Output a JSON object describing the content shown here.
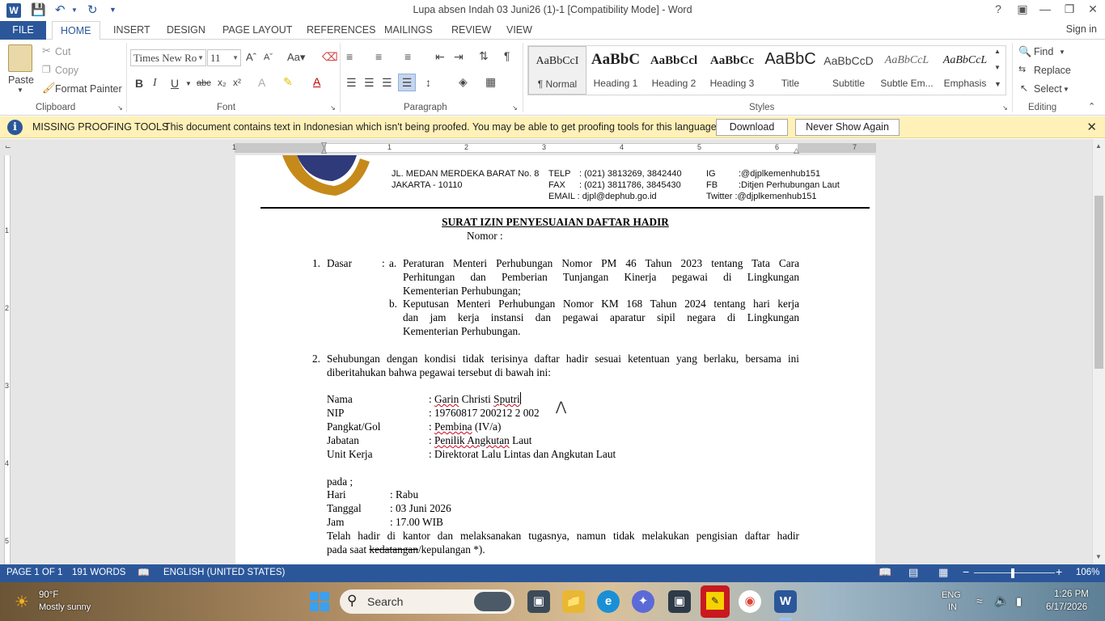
{
  "window": {
    "title": "Lupa absen Indah 03 Juni26 (1)-1 [Compatibility Mode] - Word",
    "logo": "W"
  },
  "tabs": {
    "file": "FILE",
    "items": [
      "HOME",
      "INSERT",
      "DESIGN",
      "PAGE LAYOUT",
      "REFERENCES",
      "MAILINGS",
      "REVIEW",
      "VIEW"
    ],
    "active": "HOME",
    "sign_in": "Sign in"
  },
  "ribbon": {
    "clipboard": {
      "paste": "Paste",
      "cut": "Cut",
      "copy": "Copy",
      "format_painter": "Format Painter",
      "label": "Clipboard"
    },
    "font": {
      "font_name": "Times New Ro",
      "font_size": "11",
      "label": "Font"
    },
    "paragraph": {
      "label": "Paragraph"
    },
    "styles": {
      "label": "Styles",
      "items": [
        {
          "sample": "AaBbCcI",
          "name": "¶ Normal"
        },
        {
          "sample": "AaBbC",
          "name": "Heading 1"
        },
        {
          "sample": "AaBbCcl",
          "name": "Heading 2"
        },
        {
          "sample": "AaBbCc",
          "name": "Heading 3"
        },
        {
          "sample": "AaBbC",
          "name": "Title"
        },
        {
          "sample": "AaBbCcD",
          "name": "Subtitle"
        },
        {
          "sample": "AaBbCcL",
          "name": "Subtle Em..."
        },
        {
          "sample": "AaBbCcL",
          "name": "Emphasis"
        }
      ]
    },
    "editing": {
      "find": "Find",
      "replace": "Replace",
      "select": "Select",
      "label": "Editing"
    }
  },
  "message_bar": {
    "title": "MISSING PROOFING TOOLS",
    "text": "This document contains text in Indonesian which isn't being proofed. You may be able to get proofing tools for this language.",
    "download": "Download",
    "never_show": "Never Show Again"
  },
  "ruler": {
    "numbers": [
      "1",
      "1",
      "2",
      "3",
      "4",
      "5",
      "6",
      "7"
    ],
    "vnumbers": [
      "1",
      "2",
      "3",
      "4",
      "5"
    ]
  },
  "document": {
    "letterhead": {
      "address1": "JL. MEDAN MERDEKA BARAT No. 8",
      "address2": "JAKARTA - 10110",
      "telp_label": "TELP",
      "telp": ": (021) 3813269, 3842440",
      "fax_label": "FAX",
      "fax": ": (021) 3811786, 3845430",
      "email": "EMAIL : djpl@dephub.go.id",
      "ig_label": "IG",
      "ig": ":@djplkemenhub151",
      "fb_label": "FB",
      "fb": ":Ditjen Perhubungan Laut",
      "twitter": "Twitter :@djplkemenhub151"
    },
    "title": "SURAT IZIN PENYESUAIAN DAFTAR HADIR",
    "nomor": "Nomor :",
    "item1_num": "1.",
    "item1_label": "Dasar",
    "item1_colon": ":",
    "item1a_letter": "a.",
    "item1a_lines": [
      "Peraturan Menteri Perhubungan Nomor PM  46 Tahun 2023 tentang Tata Cara",
      "Perhitungan dan Pemberian Tunjangan Kinerja pegawai di Lingkungan",
      "Kementerian Perhubungan;"
    ],
    "item1b_letter": "b.",
    "item1b_lines": [
      "Keputusan Menteri Perhubungan Nomor KM 168 Tahun 2024 tentang hari kerja",
      "dan jam kerja instansi dan pegawai aparatur sipil negara di Lingkungan",
      "Kementerian Perhubungan."
    ],
    "item2_num": "2.",
    "item2_lines": [
      "Sehubungan dengan kondisi tidak terisinya daftar hadir sesuai ketentuan yang berlaku, bersama ini",
      "diberitahukan bahwa pegawai tersebut di bawah ini:"
    ],
    "fields": [
      {
        "label": "Nama",
        "sep": ": ",
        "value": "Garin",
        "value2": " Christi ",
        "value3": "Sputri"
      },
      {
        "label": "NIP",
        "sep": ": ",
        "value": "19760817 200212 2 002"
      },
      {
        "label": "Pangkat/Gol",
        "sep": ": ",
        "value": "Pembina",
        "value2": " (IV/a)"
      },
      {
        "label": "Jabatan",
        "sep": ": ",
        "value": "Penilik Angkutan",
        "value2": " Laut"
      },
      {
        "label": "Unit Kerja",
        "sep": ": ",
        "value": "Direktorat Lalu Lintas dan Angkutan Laut"
      }
    ],
    "pada": "pada ;",
    "schedule": [
      {
        "label": "Hari",
        "value": ": Rabu"
      },
      {
        "label": "Tanggal",
        "value": ": 03 Juni 2026"
      },
      {
        "label": "Jam",
        "value": ": 17.00 WIB"
      }
    ],
    "closing_line1": "Telah hadir di kantor dan melaksanakan tugasnya, namun tidak melakukan pengisian daftar hadir",
    "closing_line2_pre": "pada saat ",
    "closing_line2_strike": "kedatangan",
    "closing_line2_post": "/kepulangan *)."
  },
  "status_bar": {
    "page": "PAGE 1 OF 1",
    "words": "191 WORDS",
    "language": "ENGLISH (UNITED STATES)",
    "zoom": "106%",
    "zoom_percent": 106
  },
  "taskbar": {
    "weather_temp": "90°F",
    "weather_desc": "Mostly sunny",
    "search": "Search",
    "lang": "ENG",
    "lang2": "IN",
    "time": "1:26 PM",
    "date": "6/17/2026"
  }
}
